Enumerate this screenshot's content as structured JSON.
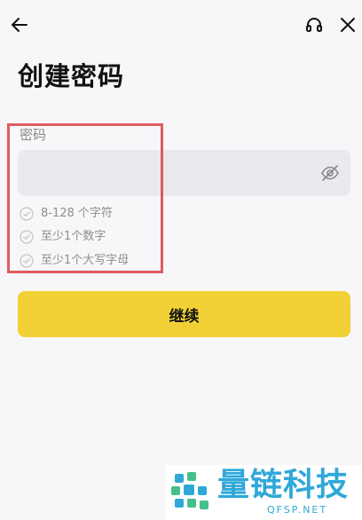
{
  "header": {
    "back_icon": "arrow-left-icon",
    "support_icon": "headset-icon",
    "close_icon": "close-icon"
  },
  "title": "创建密码",
  "password": {
    "label": "密码",
    "value": "",
    "placeholder": "",
    "toggle_icon": "eye-off-icon"
  },
  "requirements": [
    {
      "text": "8-128 个字符",
      "met": false
    },
    {
      "text": "至少1个数字",
      "met": false
    },
    {
      "text": "至少1个大写字母",
      "met": false
    }
  ],
  "continue_label": "继续",
  "watermark": {
    "name": "量链科技",
    "domain": "QFSP.NET"
  },
  "colors": {
    "accent": "#f2d136",
    "background": "#f7f6f8",
    "field": "#ebe9ee",
    "highlight": "#e05a5e",
    "watermark": "#2fa8d8"
  }
}
